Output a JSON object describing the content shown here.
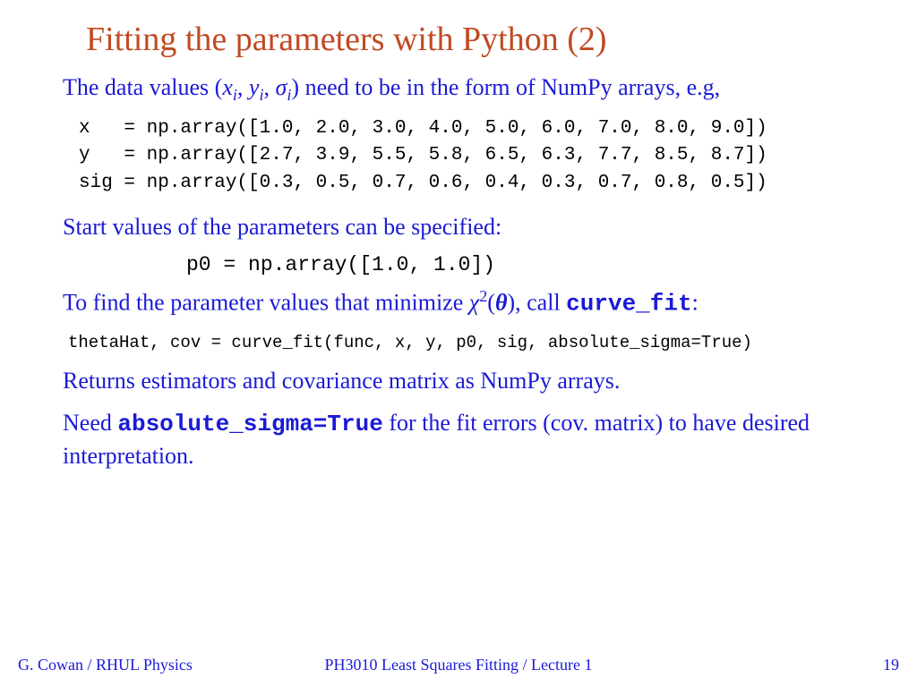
{
  "title": "Fitting the parameters with Python (2)",
  "p1_a": "The data values (",
  "p1_x": "x",
  "p1_i1": "i",
  "p1_c1": ", ",
  "p1_y": "y",
  "p1_i2": "i",
  "p1_c2": ", ",
  "p1_s": "σ",
  "p1_i3": "i",
  "p1_b": ") need to be in the form of NumPy arrays, e.g,",
  "code1": "x   = np.array([1.0, 2.0, 3.0, 4.0, 5.0, 6.0, 7.0, 8.0, 9.0])\ny   = np.array([2.7, 3.9, 5.5, 5.8, 6.5, 6.3, 7.7, 8.5, 8.7])\nsig = np.array([0.3, 0.5, 0.7, 0.6, 0.4, 0.3, 0.7, 0.8, 0.5])",
  "p2": "Start values of the parameters can be specified:",
  "code2": "p0 = np.array([1.0, 1.0])",
  "p3_a": "To find the parameter values that minimize ",
  "p3_chi": "χ",
  "p3_sup": "2",
  "p3_lp": "(",
  "p3_theta": "θ",
  "p3_rp": "), call ",
  "p3_code": "curve_fit",
  "p3_colon": ":",
  "code3": "thetaHat, cov = curve_fit(func, x, y, p0, sig, absolute_sigma=True)",
  "p4": "Returns estimators and covariance matrix as NumPy arrays.",
  "p5_a": "Need ",
  "p5_code": "absolute_sigma=True",
  "p5_b": " for the fit errors (cov. matrix) to have desired interpretation.",
  "footer": {
    "left": "G. Cowan / RHUL Physics",
    "center": "PH3010 Least Squares Fitting / Lecture 1",
    "right": "19"
  }
}
